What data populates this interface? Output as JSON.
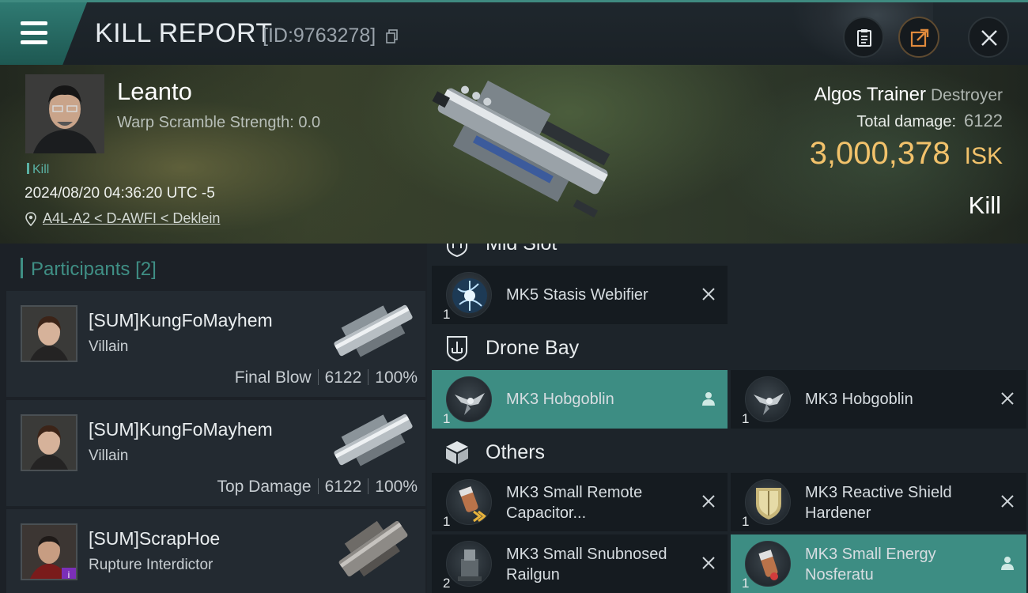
{
  "header": {
    "title": "KILL REPORT",
    "report_id": "[ID:9763278]"
  },
  "victim": {
    "name": "Leanto",
    "warp_scramble": "Warp Scramble Strength: 0.0",
    "tag": "Kill",
    "timestamp": "2024/08/20 04:36:20 UTC -5",
    "location": "A4L-A2 < D-AWFI < Deklein",
    "ship_name": "Algos Trainer",
    "ship_class": "Destroyer",
    "total_damage_label": "Total damage:",
    "total_damage_value": "6122",
    "isk_value": "3,000,378",
    "isk_unit": "ISK",
    "result": "Kill"
  },
  "participants": {
    "heading": "Participants",
    "count": "[2]",
    "list": [
      {
        "name": "[SUM]KungFoMayhem",
        "ship": "Villain",
        "role": "Final Blow",
        "damage": "6122",
        "percent": "100%"
      },
      {
        "name": "[SUM]KungFoMayhem",
        "ship": "Villain",
        "role": "Top Damage",
        "damage": "6122",
        "percent": "100%"
      },
      {
        "name": "[SUM]ScrapHoe",
        "ship": "Rupture Interdictor"
      }
    ]
  },
  "fittings": {
    "mid_slot": {
      "title": "Mid Slot",
      "items": [
        {
          "name": "MK5 Stasis Webifier",
          "qty": "1"
        }
      ]
    },
    "drone_bay": {
      "title": "Drone Bay",
      "items": [
        {
          "name": "MK3  Hobgoblin",
          "qty": "1"
        },
        {
          "name": "MK3  Hobgoblin",
          "qty": "1"
        }
      ]
    },
    "others": {
      "title": "Others",
      "items": [
        {
          "name": "MK3 Small Remote Capacitor...",
          "qty": "1"
        },
        {
          "name": "MK3 Reactive Shield Hardener",
          "qty": "1"
        },
        {
          "name": "MK3 Small Snubnosed Railgun",
          "qty": "2"
        },
        {
          "name": "MK3 Small Energy Nosferatu",
          "qty": "1"
        }
      ]
    }
  },
  "colors": {
    "accent_teal": "#3d8d83",
    "isk_gold": "#f2c26b",
    "identity_badge": "#7b2fb8"
  },
  "icons": {
    "menu": "hamburger-icon",
    "copy": "copy-icon",
    "clipboard": "clipboard-icon",
    "share": "share-icon",
    "close": "close-icon",
    "location": "location-pin-icon",
    "drone_bay": "drone-bay-icon",
    "others": "cube-icon",
    "mid_slot": "mid-slot-icon",
    "remove": "x-icon",
    "user": "user-icon"
  }
}
